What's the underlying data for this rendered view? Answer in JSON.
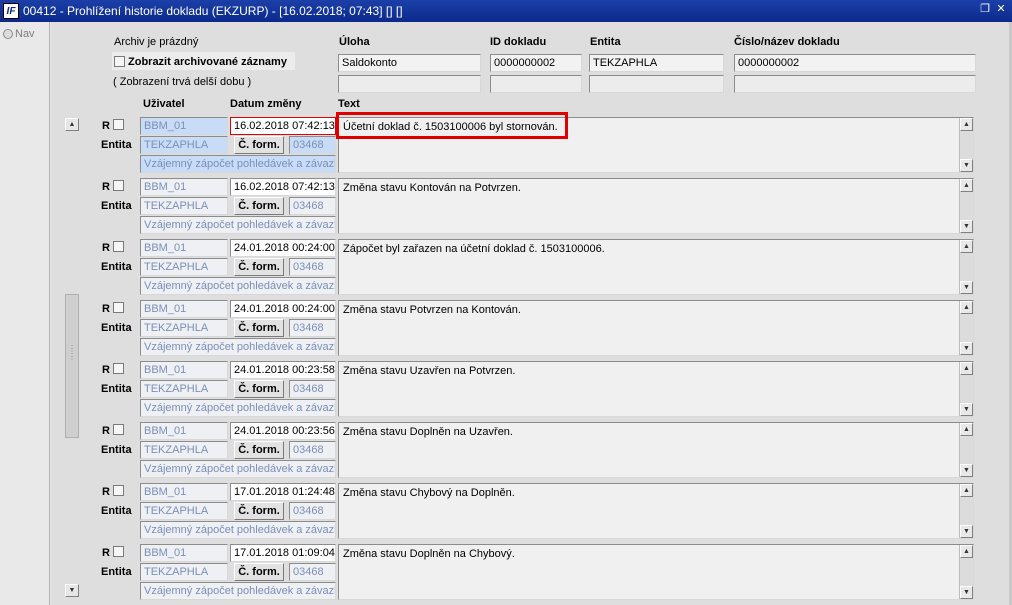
{
  "window": {
    "title": "00412 - Prohlížení historie dokladu (EKZURP) - [16.02.2018; 07:43] [] []",
    "app_icon": "IF"
  },
  "nav": {
    "label": "Nav"
  },
  "header": {
    "archiv_empty": "Archiv je prázdný",
    "show_archived": "Zobrazit archivované záznamy",
    "slow_note": "( Zobrazení trvá delší dobu )",
    "col_uloha": "Úloha",
    "col_id": "ID dokladu",
    "col_entita": "Entita",
    "col_cislo": "Číslo/název dokladu",
    "uloha_value": "Saldokonto",
    "id_value": "0000000002",
    "entita_value": "TEKZAPHLA",
    "cislo_value": "0000000002"
  },
  "columns": {
    "uzivatel": "Uživatel",
    "datum": "Datum změny",
    "text": "Text"
  },
  "labels": {
    "r": "R",
    "entita": "Entita",
    "cform": "Č. form."
  },
  "records": [
    {
      "user": "BBM_01",
      "date": "16.02.2018 07:42:13",
      "entity": "TEKZAPHLA",
      "form": "03468",
      "desc": "Vzájemný zápočet pohledávek a závazků",
      "text": "Účetní doklad č. 1503100006 byl stornován."
    },
    {
      "user": "BBM_01",
      "date": "16.02.2018 07:42:13",
      "entity": "TEKZAPHLA",
      "form": "03468",
      "desc": "Vzájemný zápočet pohledávek a závazků",
      "text": "Změna stavu Kontován na Potvrzen."
    },
    {
      "user": "BBM_01",
      "date": "24.01.2018 00:24:00",
      "entity": "TEKZAPHLA",
      "form": "03468",
      "desc": "Vzájemný zápočet pohledávek a závazků",
      "text": "Zápočet byl zařazen na účetní doklad č. 1503100006."
    },
    {
      "user": "BBM_01",
      "date": "24.01.2018 00:24:00",
      "entity": "TEKZAPHLA",
      "form": "03468",
      "desc": "Vzájemný zápočet pohledávek a závazků",
      "text": "Změna stavu Potvrzen na Kontován."
    },
    {
      "user": "BBM_01",
      "date": "24.01.2018 00:23:58",
      "entity": "TEKZAPHLA",
      "form": "03468",
      "desc": "Vzájemný zápočet pohledávek a závazků",
      "text": "Změna stavu Uzavřen na Potvrzen."
    },
    {
      "user": "BBM_01",
      "date": "24.01.2018 00:23:56",
      "entity": "TEKZAPHLA",
      "form": "03468",
      "desc": "Vzájemný zápočet pohledávek a závazků",
      "text": "Změna stavu Doplněn na Uzavřen."
    },
    {
      "user": "BBM_01",
      "date": "17.01.2018 01:24:48",
      "entity": "TEKZAPHLA",
      "form": "03468",
      "desc": "Vzájemný zápočet pohledávek a závazků",
      "text": "Změna stavu Chybový na Doplněn."
    },
    {
      "user": "BBM_01",
      "date": "17.01.2018 01:09:04",
      "entity": "TEKZAPHLA",
      "form": "03468",
      "desc": "Vzájemný zápočet pohledávek a závazků",
      "text": "Změna stavu Doplněn na Chybový."
    }
  ],
  "colors": {
    "titlebar": "#0b2a8c",
    "highlight_border": "#e00000",
    "selected_field": "#c9dcf7"
  }
}
